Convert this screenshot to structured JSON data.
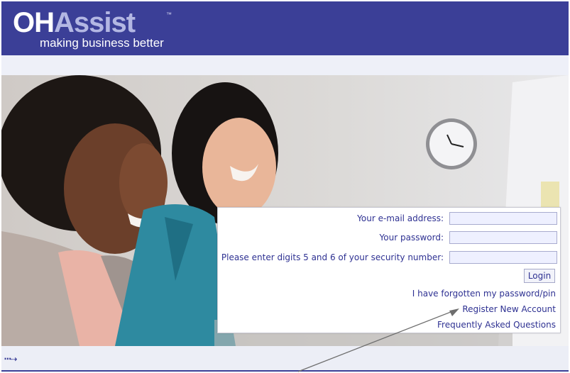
{
  "header": {
    "logo_oh": "OH",
    "logo_assist": "Assist",
    "logo_tm": "™",
    "tagline": "making business better"
  },
  "login": {
    "email_label": "Your e-mail address:",
    "email_value": "",
    "password_label": "Your password:",
    "password_value": "",
    "security_label": "Please enter digits 5 and 6 of your security number:",
    "security_value": "",
    "login_button": "Login",
    "forgot_link": "I have forgotten my password/pin",
    "register_link": "Register New Account",
    "faq_link": "Frequently Asked Questions"
  },
  "footer": {
    "arrow_glyph": "⋯⇢"
  },
  "colors": {
    "brand": "#3b3f97",
    "link": "#2e3192",
    "input_bg": "#eef0ff"
  },
  "icons": [
    "dotted-arrow-icon",
    "annotation-arrow"
  ]
}
